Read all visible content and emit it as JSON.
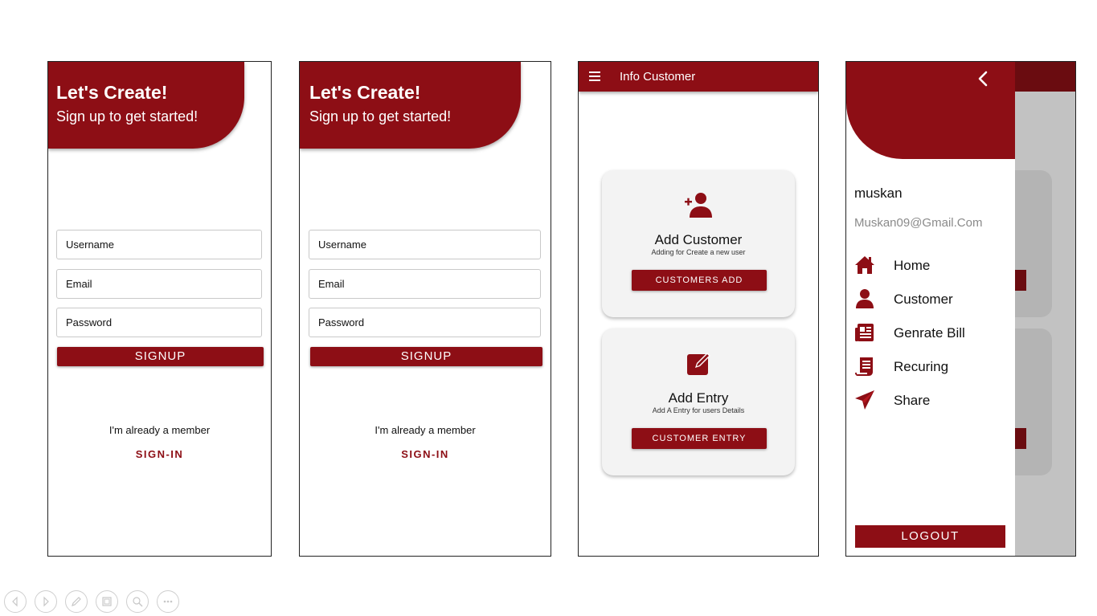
{
  "colors": {
    "accent": "#8d0e15",
    "accent_dark": "#6a0c10",
    "overlay": "#c2c2c2"
  },
  "signup": {
    "title": "Let's Create!",
    "subtitle": "Sign up to get started!",
    "username_placeholder": "Username",
    "email_placeholder": "Email",
    "password_placeholder": "Password",
    "signup_label": "SIGNUP",
    "member_text": "I'm already a member",
    "signin_label": "SIGN-IN"
  },
  "info_customer": {
    "title": "Info Customer",
    "menu_icon": "hamburger-menu-icon",
    "cards": [
      {
        "icon": "add-person-icon",
        "title": "Add Customer",
        "subtitle": "Adding for Create a new user",
        "button": "CUSTOMERS ADD"
      },
      {
        "icon": "edit-note-icon",
        "title": "Add Entry",
        "subtitle": "Add A Entry for users Details",
        "button": "CUSTOMER ENTRY"
      }
    ]
  },
  "drawer": {
    "back_icon": "chevron-left-icon",
    "username": "muskan",
    "email": "Muskan09@Gmail.Com",
    "items": [
      {
        "icon": "home-icon",
        "label": "Home"
      },
      {
        "icon": "person-icon",
        "label": "Customer"
      },
      {
        "icon": "newspaper-icon",
        "label": "Genrate Bill"
      },
      {
        "icon": "receipt-icon",
        "label": "Recuring"
      },
      {
        "icon": "paper-plane-icon",
        "label": "Share"
      }
    ],
    "logout_label": "LOGOUT"
  },
  "slideshow_controls": [
    "previous-icon",
    "next-icon",
    "pen-icon",
    "slides-icon",
    "zoom-icon",
    "more-icon"
  ]
}
